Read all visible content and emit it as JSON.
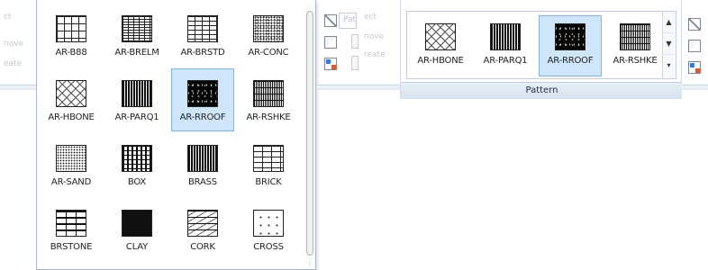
{
  "left_ribbon": {
    "fragments": [
      "ct",
      "nove",
      "eate"
    ]
  },
  "gallery": {
    "items": [
      {
        "label": "AR-B88",
        "pattern": "p-b88",
        "selected": false
      },
      {
        "label": "AR-BRELM",
        "pattern": "p-brelm",
        "selected": false
      },
      {
        "label": "AR-BRSTD",
        "pattern": "p-brstd",
        "selected": false
      },
      {
        "label": "AR-CONC",
        "pattern": "p-conc",
        "selected": false
      },
      {
        "label": "AR-HBONE",
        "pattern": "p-hbone",
        "selected": false
      },
      {
        "label": "AR-PARQ1",
        "pattern": "p-parq",
        "selected": false
      },
      {
        "label": "AR-RROOF",
        "pattern": "p-rroof",
        "selected": true
      },
      {
        "label": "AR-RSHKE",
        "pattern": "p-rshke",
        "selected": false
      },
      {
        "label": "AR-SAND",
        "pattern": "p-sand",
        "selected": false
      },
      {
        "label": "BOX",
        "pattern": "p-box",
        "selected": false
      },
      {
        "label": "BRASS",
        "pattern": "p-brass",
        "selected": false
      },
      {
        "label": "BRICK",
        "pattern": "p-brick",
        "selected": false
      },
      {
        "label": "BRSTONE",
        "pattern": "p-brstone",
        "selected": false
      },
      {
        "label": "CLAY",
        "pattern": "p-clay",
        "selected": false
      },
      {
        "label": "CORK",
        "pattern": "p-cork",
        "selected": false
      },
      {
        "label": "CROSS",
        "pattern": "p-cross",
        "selected": false
      }
    ]
  },
  "mid_ribbon": {
    "pattern_field_text": "Pat",
    "fragments": [
      "ect",
      "nove",
      "reate"
    ]
  },
  "ribbon_panel": {
    "caption": "Pattern",
    "items": [
      {
        "label": "AR-HBONE",
        "pattern": "p-hbone",
        "selected": false
      },
      {
        "label": "AR-PARQ1",
        "pattern": "p-parq",
        "selected": false
      },
      {
        "label": "AR-RROOF",
        "pattern": "p-rroof",
        "selected": true
      },
      {
        "label": "AR-RSHKE",
        "pattern": "p-rshke",
        "selected": false
      }
    ],
    "scroll_buttons": [
      "▲",
      "▼",
      "▾"
    ]
  },
  "colors": {
    "selected_bg": "#cfe5f9",
    "selected_border": "#7eb4ea",
    "panel_border": "#c1cddd"
  }
}
